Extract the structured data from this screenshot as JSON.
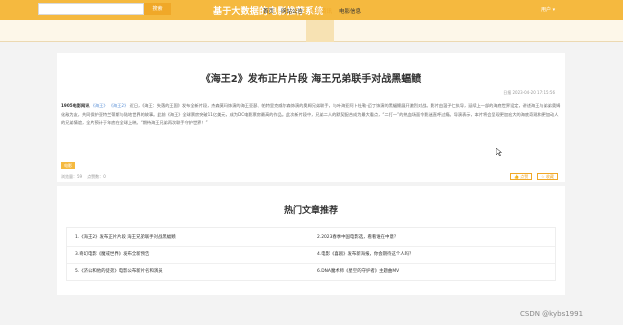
{
  "header": {
    "search_placeholder": "",
    "search_button": "搜索",
    "site_title": "基于大数据的电影推荐系统",
    "user_menu": "用户 ▾"
  },
  "nav": {
    "items": [
      {
        "label": "首页",
        "active": false
      },
      {
        "label": "网站公告",
        "active": false
      },
      {
        "label": "电影资讯",
        "active": true
      },
      {
        "label": "电影信息",
        "active": false
      }
    ]
  },
  "article": {
    "title": "《海王2》发布正片片段 海王兄弟联手对战黑蝠鲼",
    "meta_source": "日报",
    "meta_date": "2023-04-20 17:15:56",
    "body_lead": "1905电影网讯",
    "body_links": [
      "《海王》",
      "《海王2》"
    ],
    "body_text": "近日，《海王：失落的王国》发布全新片段，杰森莫玛饰演的海王亚瑟、帕特里克威尔森饰演的奥姆兄弟联手，与叶海亚阿卜杜勒-迈丁饰演的黑蝠鲼展开激烈对战。影片由温子仁执导，延续上一部的海底世界设定，讲述海王与弟弟奥姆化敌为友，共同保护亚特兰蒂斯与陆地世界的故事。此前《海王》全球票房突破11亿美元，成为DC电影票房最高的作品。此次新片段中，兄弟二人的默契配合成为最大看点，“二打一”的热血场面令影迷直呼过瘾。导演表示，本片将会呈现更加宏大的海底奇观和更加动人的兄弟情谊，全片预计于年底在全球上映。“期待海王兄弟再次联手守护世界！”"
  },
  "actions": {
    "tag": "电影",
    "stats_views_label": "浏览量：",
    "stats_views": "59",
    "stats_likes_label": "点赞数：",
    "stats_likes": "0",
    "like_button": "👍 点赞",
    "collect_button": "☆ 收藏"
  },
  "hot": {
    "title": "热门文章推荐",
    "items": [
      "1.《海王2》发布正片片段 海王兄弟联手对战黑蝠鲼",
      "2.2023春季中国电影选，看看谁在中意？",
      "3.奇幻电影《魔戒世界》发布全新预告",
      "4.电影《喜剧》发布新海报，你会期待这个人吗？",
      "5.《济公和他的徒弟》电影公布新片名和演员",
      "6.DNA魔术师《星空的守护者》主题曲MV"
    ]
  },
  "watermark": "CSDN @kybs1991",
  "colors": {
    "brand": "#f5b93f",
    "accent": "#f0a828",
    "nav_bg": "#fdf7e9"
  }
}
